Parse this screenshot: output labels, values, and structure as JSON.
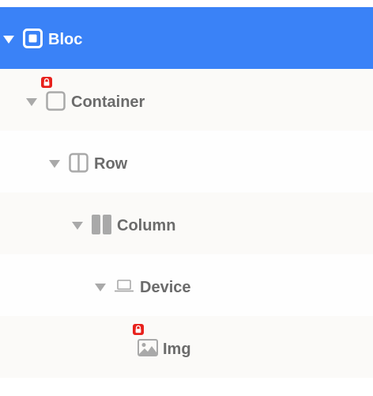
{
  "tree": {
    "nodes": [
      {
        "label": "Bloc",
        "selected": true,
        "icon": "bloc-square-icon",
        "expanded": true
      },
      {
        "label": "Container",
        "icon": "container-square-icon",
        "locked": true,
        "expanded": true
      },
      {
        "label": "Row",
        "icon": "row-columns-icon",
        "expanded": true
      },
      {
        "label": "Column",
        "icon": "column-bars-icon",
        "expanded": true
      },
      {
        "label": "Device",
        "icon": "laptop-icon",
        "expanded": true
      },
      {
        "label": "Img",
        "icon": "image-icon",
        "locked": true
      }
    ]
  },
  "colors": {
    "selection": "#3a82f7",
    "label": "#6b6b6b",
    "icon": "#a9a9a9",
    "lock_badge": "#e8211c"
  }
}
